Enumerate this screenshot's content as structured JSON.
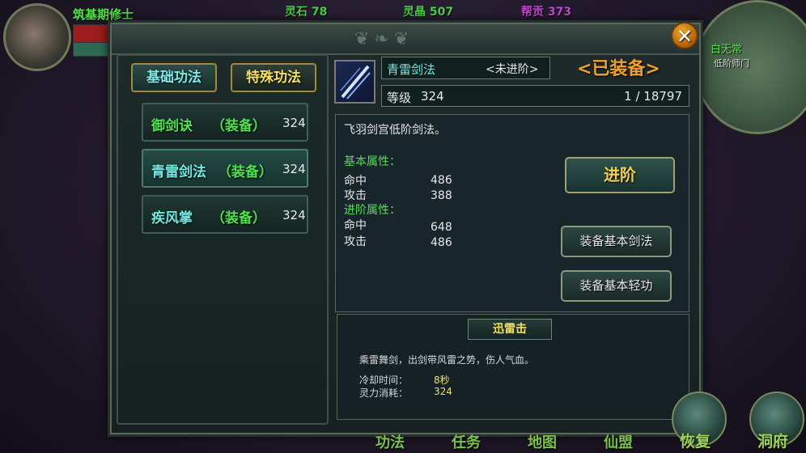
{
  "hud": {
    "player_name": "筑基期修士",
    "stats": [
      {
        "label": "灵石 78",
        "color": "#4fcf4a"
      },
      {
        "label": "灵晶 507",
        "color": "#4fcf4a"
      },
      {
        "label": "帮贡 373",
        "color": "#c04ad0"
      }
    ],
    "map_name": "白无常",
    "map_sub": "低阶师门"
  },
  "left_panel": {
    "tabs": [
      {
        "label": "基础功法",
        "active": true
      },
      {
        "label": "特殊功法",
        "active": false
      }
    ],
    "skills": [
      {
        "name": "御剑诀",
        "equip": "（装备）",
        "level": "324",
        "name_color": "#50e050"
      },
      {
        "name": "青雷剑法",
        "equip": "（装备）",
        "level": "324",
        "name_color": "#6fe8e0"
      },
      {
        "name": "疾风掌",
        "equip": "（装备）",
        "level": "324",
        "name_color": "#6fe8e0"
      }
    ]
  },
  "detail": {
    "skill_title": "青雷剑法",
    "advance_state": "<未进阶>",
    "equipped_label": "<已装备>",
    "level_label": "等级",
    "level_value": "324",
    "exp": "1 / 18797",
    "description": "飞羽剑宫低阶剑法。",
    "base_attr_title": "基本属性：",
    "base_attrs": [
      {
        "key": "命中",
        "value": "486"
      },
      {
        "key": "攻击",
        "value": "388"
      }
    ],
    "adv_attr_title": "进阶属性：",
    "adv_attrs": [
      {
        "key": "命中",
        "value": "648"
      },
      {
        "key": "攻击",
        "value": "486"
      }
    ],
    "buttons": {
      "advance": "进阶",
      "equip_sword": "装备基本剑法",
      "equip_light": "装备基本轻功"
    }
  },
  "special_skill": {
    "name": "迅雷击",
    "description": "乘雷舞剑，出剑带风雷之势，伤人气血。",
    "cooldown_label": "冷却时间：",
    "cooldown_value": "8秒",
    "cost_label": "灵力消耗：",
    "cost_value": "324"
  },
  "bottom_menu": [
    "功法",
    "任务",
    "地图",
    "仙盟",
    "恢复",
    "洞府"
  ],
  "close_icon_glyph": "✕"
}
